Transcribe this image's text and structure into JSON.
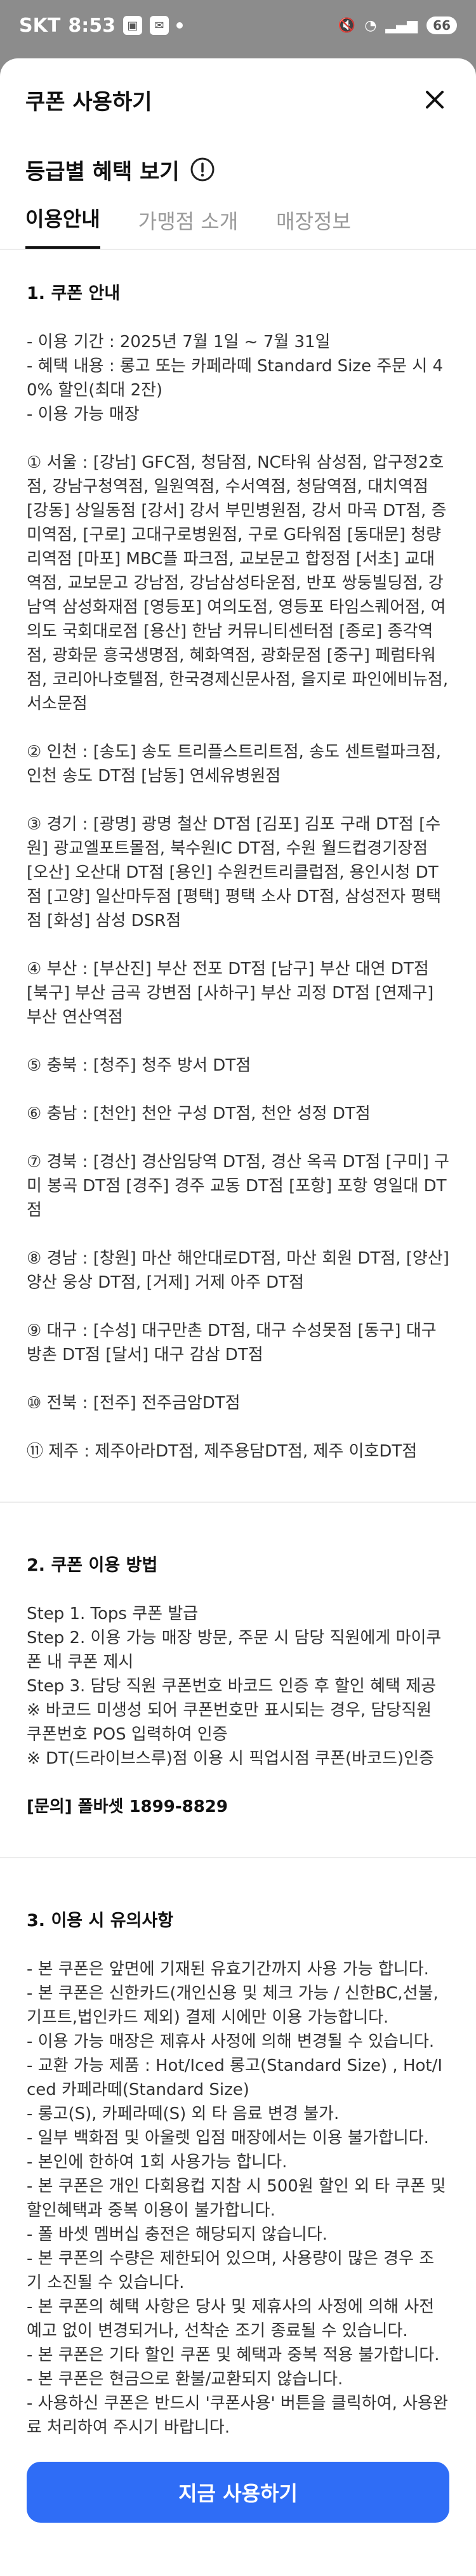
{
  "status_bar": {
    "carrier": "SKT",
    "time": "8:53",
    "battery": "66"
  },
  "sheet": {
    "title": "쿠폰 사용하기",
    "benefit_title": "등급별 혜택 보기"
  },
  "tabs": [
    {
      "label": "이용안내",
      "active": true
    },
    {
      "label": "가맹점 소개",
      "active": false
    },
    {
      "label": "매장정보",
      "active": false
    }
  ],
  "guide": {
    "s1_title": "1. 쿠폰 안내",
    "s1_lines": "- 이용 기간 : 2025년 7월 1일 ~ 7월 31일\n- 혜택 내용 : 롱고 또는 카페라떼 Standard Size 주문 시 40% 할인(최대 2잔)\n- 이용 가능 매장",
    "stores": [
      "① 서울 : [강남] GFC점, 청담점, NC타워 삼성점, 압구정2호점, 강남구청역점, 일원역점, 수서역점, 청담역점, 대치역점 [강동] 상일동점 [강서] 강서 부민병원점, 강서 마곡 DT점, 증미역점, [구로] 고대구로병원점, 구로 G타워점 [동대문] 청량리역점 [마포] MBC플 파크점, 교보문고 합정점 [서초] 교대역점, 교보문고 강남점, 강남삼성타운점, 반포 쌍둥빌딩점, 강남역 삼성화재점 [영등포] 여의도점, 영등포 타임스퀘어점, 여의도 국회대로점 [용산] 한남 커뮤니티센터점 [종로] 종각역점, 광화문 흥국생명점, 혜화역점, 광화문점 [중구] 페럼타워점, 코리아나호텔점, 한국경제신문사점, 을지로 파인에비뉴점, 서소문점",
      "② 인천 : [송도] 송도 트리플스트리트점, 송도 센트럴파크점, 인천 송도 DT점 [남동] 연세유병원점",
      "③ 경기 : [광명] 광명 철산 DT점 [김포] 김포 구래 DT점 [수원] 광교엘포트몰점, 북수원IC DT점, 수원 월드컵경기장점 [오산] 오산대 DT점 [용인] 수원컨트리클럽점, 용인시청 DT점 [고양] 일산마두점 [평택] 평택 소사 DT점, 삼성전자 평택점 [화성] 삼성 DSR점",
      "④ 부산 : [부산진] 부산 전포 DT점 [남구] 부산 대연 DT점 [북구] 부산 금곡 강변점 [사하구] 부산 괴정 DT점 [연제구] 부산 연산역점",
      "⑤ 충북 : [청주] 청주 방서 DT점",
      "⑥ 충남 : [천안] 천안 구성 DT점, 천안 성정 DT점",
      "⑦ 경북 : [경산] 경산임당역 DT점, 경산 옥곡 DT점 [구미] 구미 봉곡 DT점 [경주] 경주 교동 DT점 [포항] 포항 영일대 DT점",
      "⑧ 경남 : [창원] 마산 해안대로DT점, 마산 회원 DT점, [양산] 양산 웅상 DT점, [거제] 거제 아주 DT점",
      "⑨ 대구 : [수성] 대구만촌 DT점, 대구 수성못점 [동구] 대구방촌 DT점 [달서] 대구 감삼 DT점",
      "⑩ 전북 : [전주] 전주금암DT점",
      "⑪ 제주 : 제주아라DT점, 제주용담DT점, 제주 이호DT점"
    ],
    "s2_title": "2. 쿠폰 이용 방법",
    "s2_lines": "Step 1. Tops 쿠폰 발급\nStep 2. 이용 가능 매장 방문, 주문 시 담당 직원에게 마이쿠폰 내 쿠폰 제시\nStep 3. 담당 직원 쿠폰번호 바코드 인증 후 할인 혜택 제공\n※ 바코드 미생성 되어 쿠폰번호만 표시되는 경우, 담당직원 쿠폰번호 POS 입력하여 인증\n※ DT(드라이브스루)점 이용 시 픽업시점 쿠폰(바코드)인증",
    "s2_contact": "[문의] 폴바셋 1899-8829",
    "s3_title": "3. 이용 시 유의사항",
    "s3_lines": "- 본 쿠폰은 앞면에 기재된 유효기간까지 사용 가능 합니다.\n- 본 쿠폰은 신한카드(개인신용 및 체크 가능 / 신한BC,선불,기프트,법인카드 제외) 결제 시에만 이용 가능합니다.\n- 이용 가능 매장은 제휴사 사정에 의해 변경될 수 있습니다.\n- 교환 가능 제품 : Hot/Iced 롱고(Standard Size) , Hot/Iced 카페라떼(Standard Size)\n- 롱고(S), 카페라떼(S) 외 타 음료 변경 불가.\n- 일부 백화점 및 아울렛 입점 매장에서는 이용 불가합니다.\n- 본인에 한하여 1회 사용가능 합니다.\n- 본 쿠폰은 개인 다회용컵 지참 시 500원 할인 외 타 쿠폰 및 할인혜택과 중복 이용이 불가합니다.\n- 폴 바셋 멤버십 충전은 해당되지 않습니다.\n- 본 쿠폰의 수량은 제한되어 있으며, 사용량이 많은 경우 조기 소진될 수 있습니다.\n- 본 쿠폰의 혜택 사항은 당사 및 제휴사의 사정에 의해 사전 예고 없이 변경되거나, 선착순 조기 종료될 수 있습니다.\n- 본 쿠폰은 기타 할인 쿠폰 및 혜택과 중복 적용 불가합니다.\n- 본 쿠폰은 현금으로 환불/교환되지 않습니다.\n- 사용하신 쿠폰은 반드시 '쿠폰사용' 버튼을 클릭하여, 사용완료 처리하여 주시기 바랍니다."
  },
  "cta": {
    "label": "지금 사용하기"
  },
  "colors": {
    "accent": "#2f6df6",
    "dim_overlay": "#8c8c8c"
  }
}
